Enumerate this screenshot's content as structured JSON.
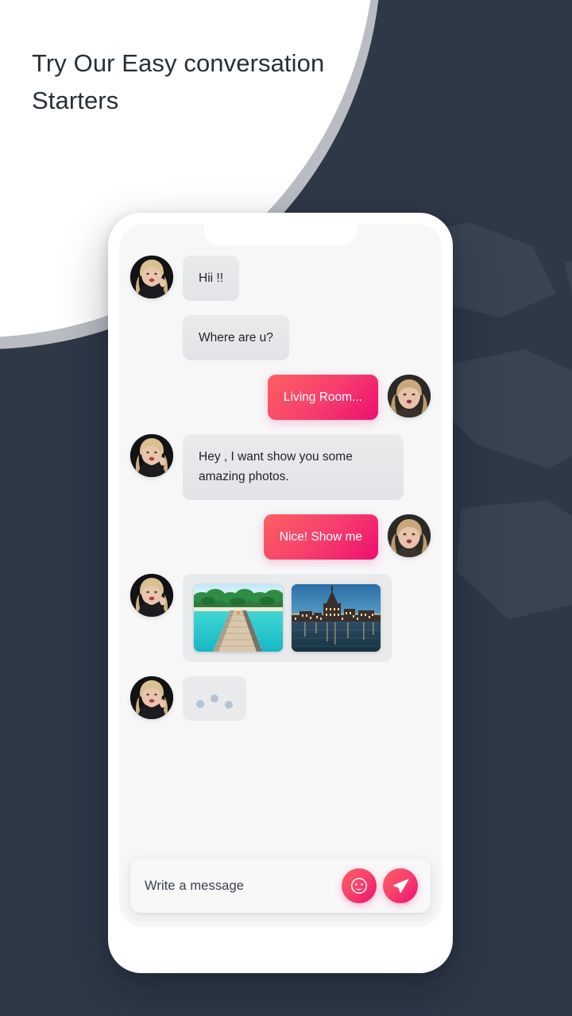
{
  "headline": "Try Our Easy conversation Starters",
  "theme": {
    "accent_start": "#fa6161",
    "accent_end": "#ec0f70",
    "dark_bg": "#2e3847",
    "arc_grey": "#a9aeb5",
    "screen_bg": "#f7f7f8",
    "bubble_in_bg": "#e6e7e9",
    "text_dark": "#1f2329"
  },
  "phone": {
    "notch": "notch"
  },
  "chat": {
    "messages": [
      {
        "id": "m1",
        "side": "in",
        "type": "text",
        "text": "Hii !!",
        "avatar": "avatar-her"
      },
      {
        "id": "m2",
        "side": "in",
        "type": "text",
        "text": "Where are u?",
        "avatar": ""
      },
      {
        "id": "m3",
        "side": "out",
        "type": "text",
        "text": "Living Room...",
        "avatar": "avatar-me"
      },
      {
        "id": "m4",
        "side": "in",
        "type": "text",
        "text": "Hey , I want show you some amazing photos.",
        "avatar": "avatar-her"
      },
      {
        "id": "m5",
        "side": "out",
        "type": "text",
        "text": "Nice! Show me",
        "avatar": "avatar-me"
      },
      {
        "id": "m6",
        "side": "in",
        "type": "photos",
        "text": "",
        "avatar": "avatar-her",
        "photos": [
          "tropical-beach-pier-photo",
          "night-city-river-photo"
        ]
      },
      {
        "id": "m7",
        "side": "in",
        "type": "typing",
        "text": "",
        "avatar": "avatar-her"
      }
    ]
  },
  "input": {
    "placeholder": "Write a message",
    "emoji_button": "emoji-icon",
    "send_button": "send-icon"
  }
}
